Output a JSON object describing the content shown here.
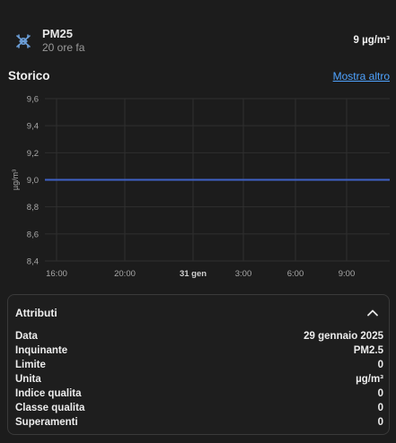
{
  "entity": {
    "name": "PM25",
    "time": "20 ore fa",
    "value": "9 µg/m³",
    "icon": "air-filter-icon"
  },
  "history": {
    "title": "Storico",
    "more_link": "Mostra altro"
  },
  "chart_data": {
    "type": "line",
    "ylabel": "µg/m³",
    "ylim": [
      8.4,
      9.6
    ],
    "yticks": [
      "9,6",
      "9,4",
      "9,2",
      "9,0",
      "8,8",
      "8,6",
      "8,4"
    ],
    "xticks": [
      "16:00",
      "20:00",
      "31 gen",
      "3:00",
      "6:00",
      "9:00"
    ],
    "grid": true,
    "series": [
      {
        "color": "#3f62c7",
        "values": [
          9.0,
          9.0
        ]
      }
    ]
  },
  "attributes": {
    "title": "Attributi",
    "rows": [
      {
        "key": "Data",
        "value": "29 gennaio 2025"
      },
      {
        "key": "Inquinante",
        "value": "PM2.5"
      },
      {
        "key": "Limite",
        "value": "0"
      },
      {
        "key": "Unita",
        "value": "µg/m³"
      },
      {
        "key": "Indice qualita",
        "value": "0"
      },
      {
        "key": "Classe qualita",
        "value": "0"
      },
      {
        "key": "Superamenti",
        "value": "0"
      }
    ]
  }
}
